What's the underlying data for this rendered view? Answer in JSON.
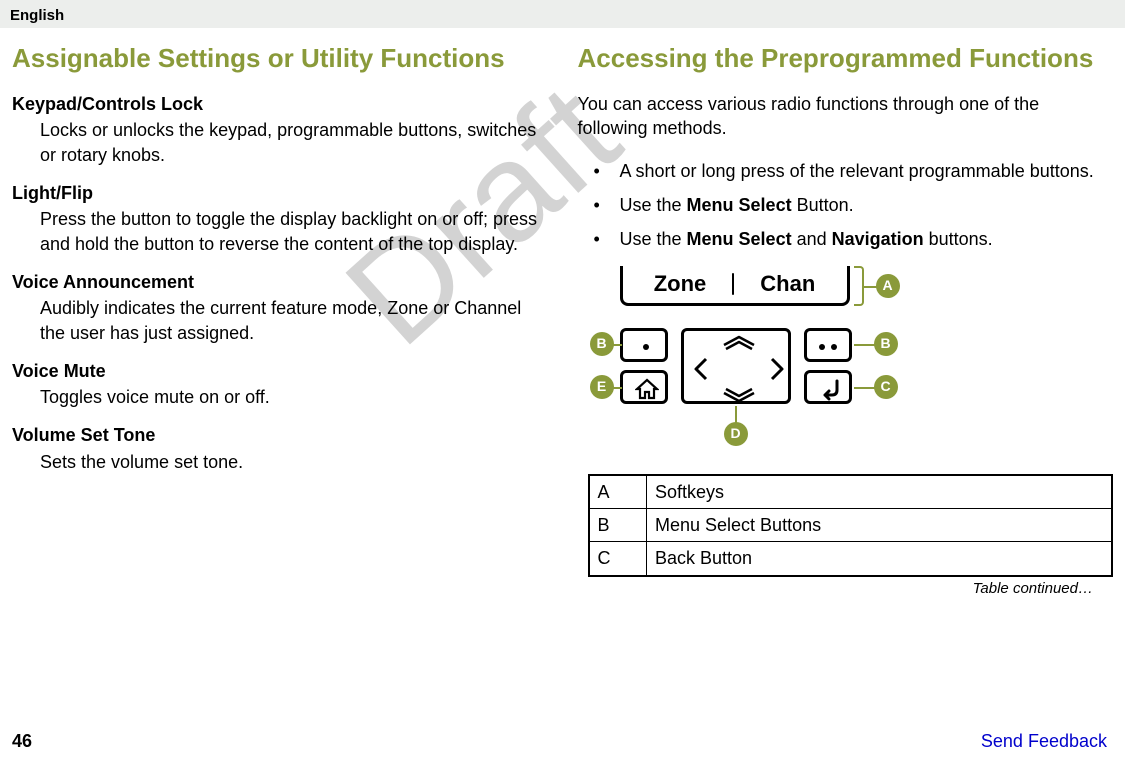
{
  "header": {
    "lang": "English"
  },
  "watermark": "Draft",
  "left": {
    "heading": "Assignable Settings or Utility Functions",
    "items": [
      {
        "term": "Keypad/Controls Lock",
        "desc": "Locks or unlocks the keypad, programmable buttons, switches or rotary knobs."
      },
      {
        "term": "Light/Flip",
        "desc": "Press the button to toggle the display backlight on or off; press and hold the button to reverse the content of the top display."
      },
      {
        "term": "Voice Announcement",
        "desc": "Audibly indicates the current feature mode, Zone or Channel the user has just assigned."
      },
      {
        "term": "Voice Mute",
        "desc": "Toggles voice mute on or off."
      },
      {
        "term": "Volume Set Tone",
        "desc": "Sets the volume set tone."
      }
    ]
  },
  "right": {
    "heading": "Accessing the Preprogrammed Functions",
    "intro": "You can access various radio functions through one of the following methods.",
    "bullets": {
      "b1": "A short or long press of the relevant programmable buttons.",
      "b2_pre": "Use the ",
      "b2_bold": "Menu Select",
      "b2_post": " Button.",
      "b3_pre": "Use the ",
      "b3_bold1": "Menu Select",
      "b3_mid": " and ",
      "b3_bold2": "Navigation",
      "b3_post": " buttons."
    },
    "diagram": {
      "screen": {
        "zone": "Zone",
        "chan": "Chan"
      },
      "labels": {
        "A": "A",
        "Bl": "B",
        "Br": "B",
        "C": "C",
        "D": "D",
        "E": "E"
      }
    },
    "table": {
      "rows": [
        {
          "k": "A",
          "v": "Softkeys"
        },
        {
          "k": "B",
          "v": "Menu Select Buttons"
        },
        {
          "k": "C",
          "v": "Back Button"
        }
      ],
      "continued": "Table continued…"
    }
  },
  "footer": {
    "page": "46",
    "link": "Send Feedback"
  }
}
